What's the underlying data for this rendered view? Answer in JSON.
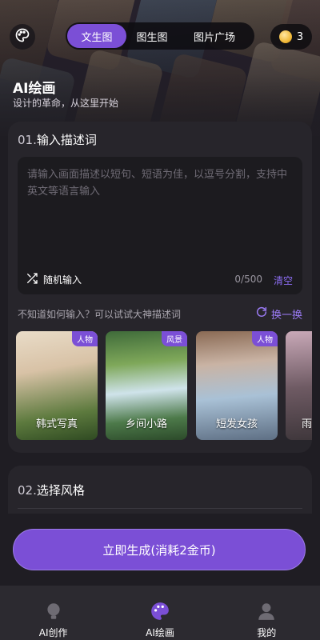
{
  "header": {
    "tabs": [
      {
        "label": "文生图",
        "active": true
      },
      {
        "label": "图生图",
        "active": false
      },
      {
        "label": "图片广场",
        "active": false
      }
    ],
    "coins": "3"
  },
  "hero": {
    "title": "AI绘画",
    "subtitle": "设计的革命，从这里开始"
  },
  "prompt_section": {
    "number": "01.",
    "title": "输入描述词",
    "placeholder": "请输入画面描述以短句、短语为佳，以逗号分割，支持中英文等语言输入",
    "random_label": "随机输入",
    "counter": "0/500",
    "clear_label": "清空",
    "hint": "不知道如何输入？可以试试大神描述词",
    "swap_label": "换一换"
  },
  "samples": [
    {
      "category": "人物",
      "name": "韩式写真"
    },
    {
      "category": "风景",
      "name": "乡间小路"
    },
    {
      "category": "人物",
      "name": "短发女孩"
    },
    {
      "category": "",
      "name": "雨"
    }
  ],
  "style_section": {
    "number": "02.",
    "title": "选择风格"
  },
  "generate_button": "立即生成(消耗2金币)",
  "bottom_nav": [
    {
      "label": "AI创作",
      "active": false
    },
    {
      "label": "AI绘画",
      "active": true
    },
    {
      "label": "我的",
      "active": false
    }
  ],
  "colors": {
    "accent": "#7b4fd6",
    "link": "#8b6cf0",
    "background": "#1f1d23",
    "card": "#27252b"
  }
}
